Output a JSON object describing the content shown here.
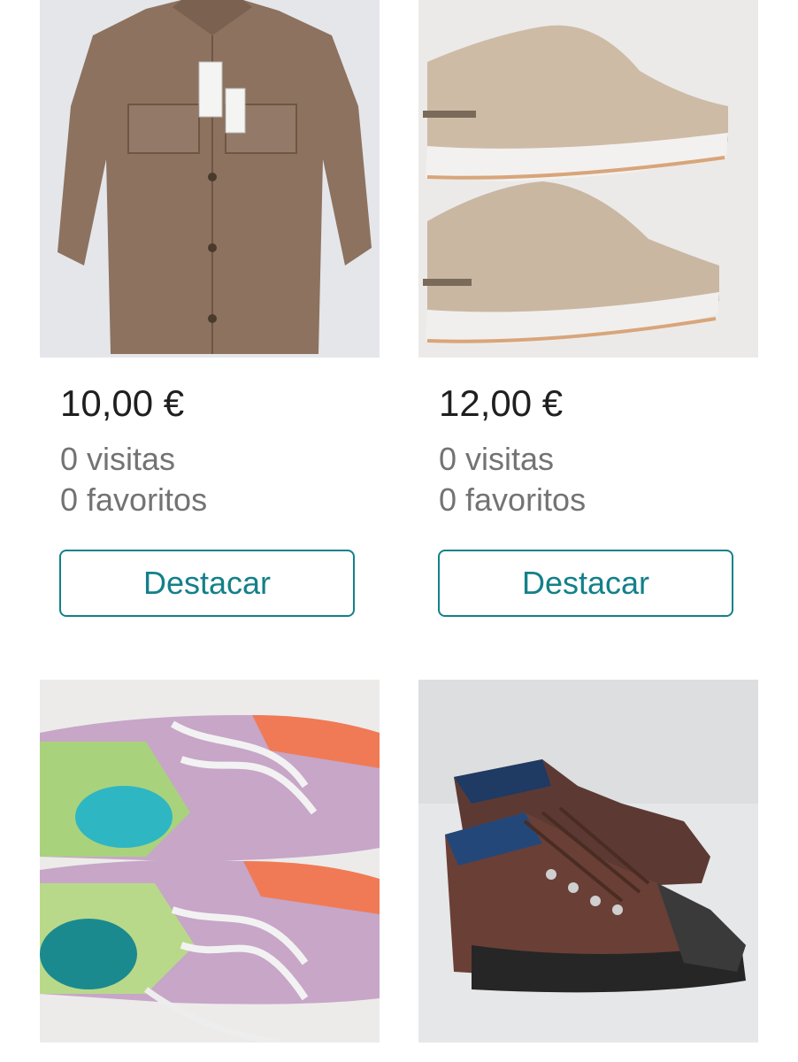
{
  "listings": [
    {
      "price": "10,00 €",
      "views": "0 visitas",
      "favorites": "0 favoritos",
      "action_label": "Destacar"
    },
    {
      "price": "12,00 €",
      "views": "0 visitas",
      "favorites": "0 favoritos",
      "action_label": "Destacar"
    },
    {},
    {}
  ],
  "colors": {
    "accent": "#13808a",
    "price_text": "#1f1f1f",
    "muted_text": "#737373"
  }
}
